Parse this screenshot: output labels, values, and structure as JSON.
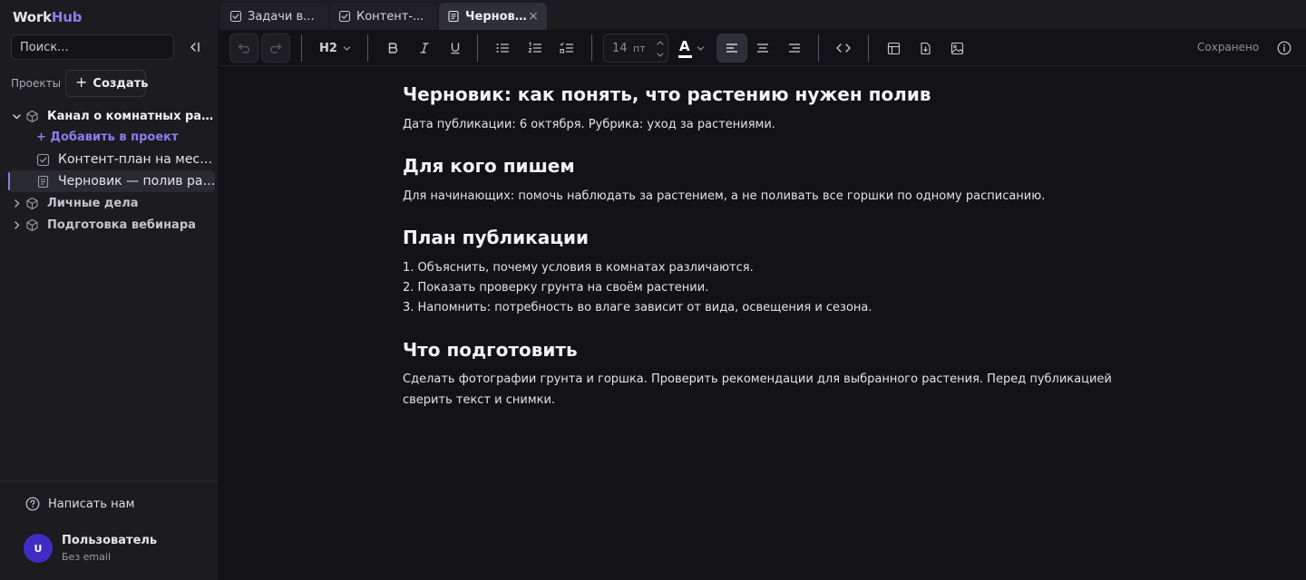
{
  "app": {
    "logo_part1": "Work",
    "logo_part2": "Hub",
    "accent": "#8b7cf0"
  },
  "sidebar": {
    "search_placeholder": "Поиск...",
    "projects_label": "Проекты",
    "create_label": "Создать",
    "tree": [
      {
        "label": "Канал о комнатных растениях",
        "expanded": true
      },
      {
        "label": "Личные дела",
        "expanded": false
      },
      {
        "label": "Подготовка вебинара",
        "expanded": false
      }
    ],
    "add_to_project": "+ Добавить в проект",
    "children": [
      {
        "label": "Контент-план на месяц",
        "icon": "checkbox-icon"
      },
      {
        "label": "Черновик — полив растений",
        "icon": "document-icon",
        "active": true
      }
    ],
    "help_label": "Написать нам",
    "user": {
      "initial": "U",
      "name": "Пользователь",
      "email": "Без email",
      "avatar_color": "#3f2cc4"
    }
  },
  "tabs": [
    {
      "label": "Задачи в...",
      "icon": "checkbox-icon",
      "active": false
    },
    {
      "label": "Контент-...",
      "icon": "checkbox-icon",
      "active": false
    },
    {
      "label": "Черновик...",
      "icon": "document-icon",
      "active": true,
      "closable": true
    }
  ],
  "toolbar": {
    "heading_level": "H2",
    "font_size": "14",
    "font_unit": "пт",
    "text_color": "#ffffff",
    "status": "Сохранено"
  },
  "document": {
    "title": "Черновик: как понять, что растению нужен полив",
    "meta": "Дата публикации: 6 октября. Рубрика: уход за растениями.",
    "sections": [
      {
        "heading": "Для кого пишем",
        "paragraph": "Для начинающих: помочь наблюдать за растением, а не поливать все горшки по одному расписанию."
      },
      {
        "heading": "План публикации",
        "items": [
          "1. Объяснить, почему условия в комнатах различаются.",
          "2. Показать проверку грунта на своём растении.",
          "3. Напомнить: потребность во влаге зависит от вида, освещения и сезона."
        ]
      },
      {
        "heading": "Что подготовить",
        "paragraph": "Сделать фотографии грунта и горшка. Проверить рекомендации для выбранного растения. Перед публикацией сверить текст и снимки."
      }
    ]
  }
}
